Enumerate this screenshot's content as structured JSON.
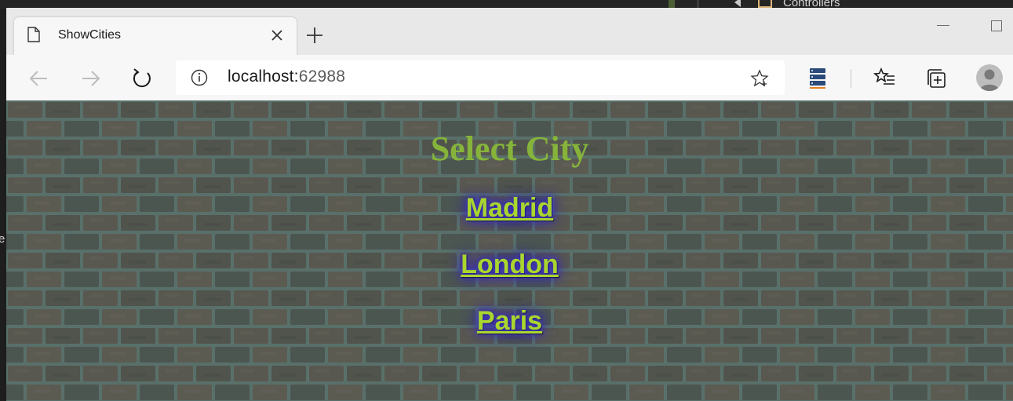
{
  "ide": {
    "tree_item_label": "Controllers",
    "left_char": "e"
  },
  "browser": {
    "tab": {
      "title": "ShowCities"
    },
    "address_bar": {
      "host": "localhost:",
      "port": "62988"
    }
  },
  "page": {
    "heading": "Select City",
    "cities": [
      {
        "label": "Madrid"
      },
      {
        "label": "London"
      },
      {
        "label": "Paris"
      }
    ],
    "colors": {
      "heading": "#86b43a",
      "link": "#a9d62e",
      "link_glow": "#3b2cc7"
    }
  }
}
